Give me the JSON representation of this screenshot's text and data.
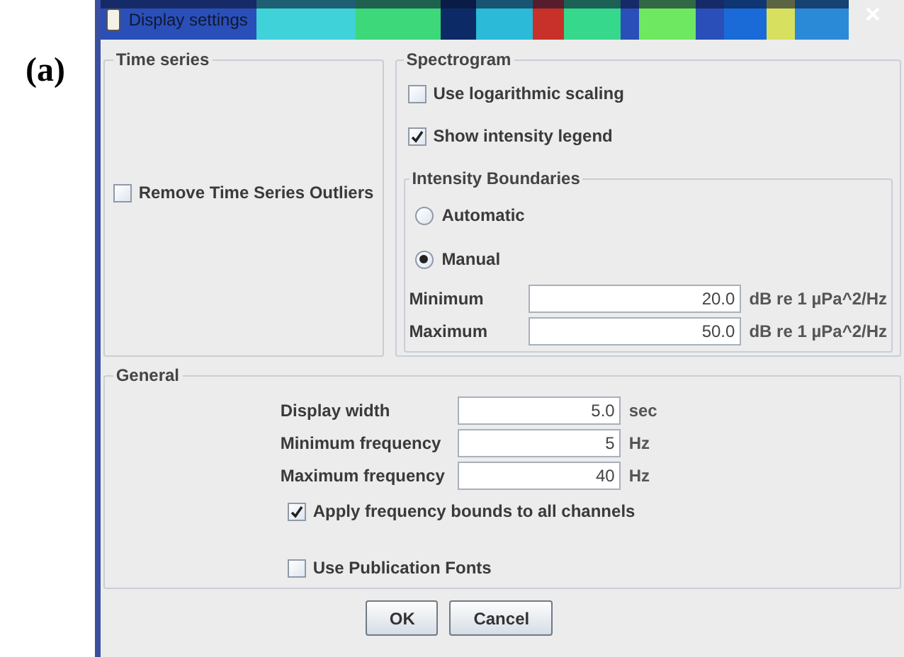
{
  "figure_label": "(a)",
  "window": {
    "title": "Display settings"
  },
  "time_series": {
    "title": "Time series",
    "options": [
      {
        "label": "Remove Time Series Outliers",
        "checked": false
      }
    ]
  },
  "spectrogram": {
    "title": "Spectrogram",
    "options": [
      {
        "label": "Use logarithmic scaling",
        "checked": false
      },
      {
        "label": "Show intensity legend",
        "checked": true
      }
    ],
    "intensity_boundaries": {
      "title": "Intensity Boundaries",
      "modes": [
        {
          "label": "Automatic",
          "selected": false
        },
        {
          "label": "Manual",
          "selected": true
        }
      ],
      "fields": [
        {
          "label": "Minimum",
          "value": "20.0",
          "unit": "dB re **1** µPa^2/Hz"
        },
        {
          "label": "Maximum",
          "value": "50.0",
          "unit": "dB re **1** µPa^2/Hz"
        }
      ]
    }
  },
  "general": {
    "title": "General",
    "fields": [
      {
        "label": "Display width",
        "value": "5.0",
        "unit": "sec"
      },
      {
        "label": "Minimum frequency",
        "value": "5",
        "unit": "Hz"
      },
      {
        "label": "Maximum frequency",
        "value": "40",
        "unit": "Hz"
      }
    ],
    "options": [
      {
        "label": "Apply frequency bounds to all channels",
        "checked": true
      },
      {
        "label": "Use Publication Fonts",
        "checked": false
      }
    ]
  },
  "buttons": [
    "OK",
    "Cancel"
  ]
}
